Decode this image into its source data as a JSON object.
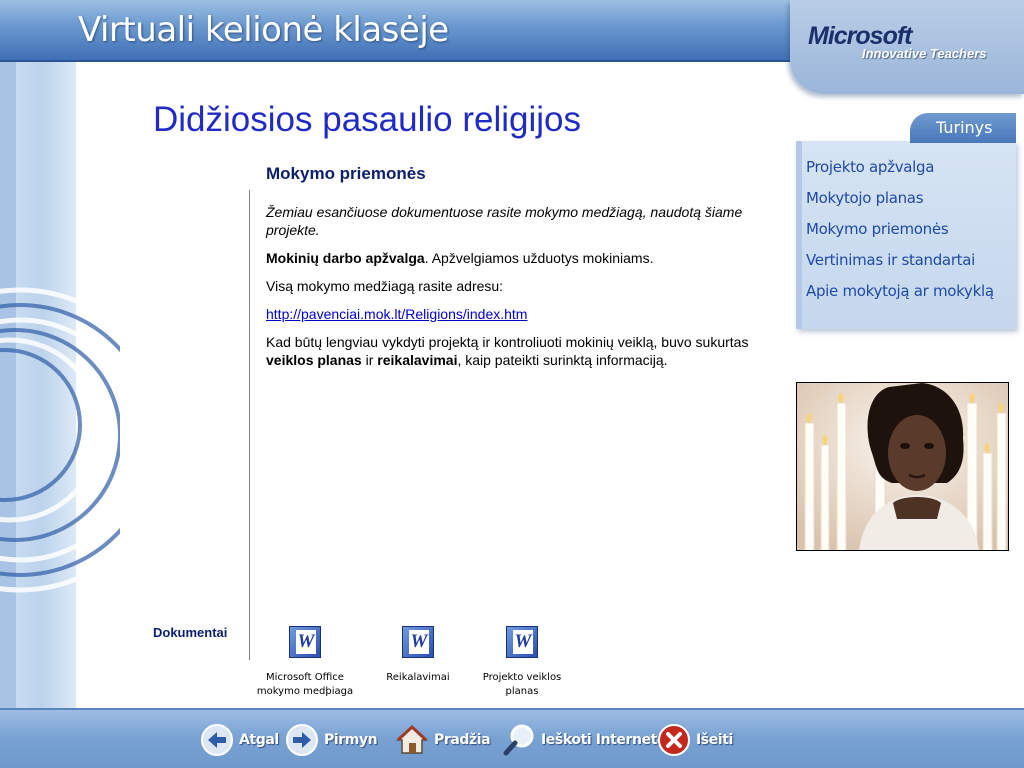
{
  "header": {
    "title": "Virtuali kelionė klasėje",
    "logo_text": "Microsoft",
    "logo_tagline": "Innovative Teachers"
  },
  "main": {
    "title": "Didžiosios pasaulio religijos",
    "section_heading": "Mokymo priemonės",
    "intro": "Žemiau esančiuose dokumentuose rasite mokymo medžiagą, naudotą šiame projekte.",
    "para1_bold": "Mokinių darbo apžvalga",
    "para1_rest": ". Apžvelgiamos užduotys mokiniams.",
    "para2": "Visą mokymo medžiagą rasite adresu:",
    "link": "http://pavenciai.mok.lt/Religions/index.htm",
    "para3_a": "Kad būtų lengviau vykdyti projektą ir kontroliuoti mokinių veiklą, buvo sukurtas ",
    "para3_bold1": "veiklos planas",
    "para3_b": " ir ",
    "para3_bold2": "reikalavimai",
    "para3_c": ", kaip pateikti surinktą informaciją."
  },
  "documents": {
    "label": "Dokumentai",
    "items": [
      {
        "line1": "Microsoft Office",
        "line2": "mokymo medþiaga",
        "icon": "word-document-icon"
      },
      {
        "line1": "Reikalavimai",
        "line2": "",
        "icon": "word-document-icon"
      },
      {
        "line1": "Projekto veiklos",
        "line2": "planas",
        "icon": "word-document-icon"
      }
    ]
  },
  "nav": {
    "tab_label": "Turinys",
    "items": [
      "Projekto apžvalga",
      "Mokytojo planas",
      "Mokymo priemonės",
      "Vertinimas ir standartai",
      "Apie mokytoją ar mokyklą"
    ]
  },
  "footer": {
    "buttons": [
      {
        "label": "Atgal",
        "icon": "back-arrow-icon"
      },
      {
        "label": "Pirmyn",
        "icon": "forward-arrow-icon"
      },
      {
        "label": "Pradžia",
        "icon": "home-icon"
      },
      {
        "label": "Ieškoti Internete",
        "icon": "magnifier-icon"
      },
      {
        "label": "Išeiti",
        "icon": "exit-x-icon"
      }
    ]
  },
  "colors": {
    "title_blue": "#1f2bc4",
    "heading_navy": "#0c1f6e",
    "nav_text": "#1f4aa8",
    "link": "#0000cc"
  }
}
